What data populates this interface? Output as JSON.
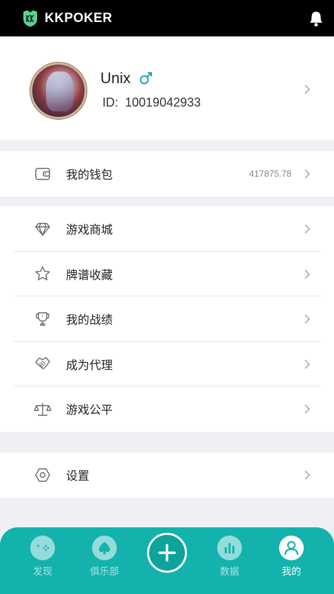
{
  "app": {
    "brand": "KKPOKER"
  },
  "profile": {
    "username": "Unix",
    "id_label": "ID:",
    "id_value": "10019042933"
  },
  "wallet": {
    "label": "我的钱包",
    "balance": "417875.78"
  },
  "menu": [
    {
      "label": "游戏商城",
      "icon": "diamond-icon"
    },
    {
      "label": "牌谱收藏",
      "icon": "star-icon"
    },
    {
      "label": "我的战绩",
      "icon": "trophy-icon"
    },
    {
      "label": "成为代理",
      "icon": "handshake-icon"
    },
    {
      "label": "游戏公平",
      "icon": "scale-icon"
    }
  ],
  "settings": {
    "label": "设置"
  },
  "tabs": [
    {
      "label": "发现",
      "icon": "gamepad-icon"
    },
    {
      "label": "俱乐部",
      "icon": "spade-icon"
    },
    {
      "label": "数据",
      "icon": "bar-chart-icon"
    },
    {
      "label": "我的",
      "icon": "user-icon",
      "active": true
    }
  ],
  "colors": {
    "accent": "#13b2ad",
    "gender": "#13a6b4",
    "topbar": "#000000"
  }
}
